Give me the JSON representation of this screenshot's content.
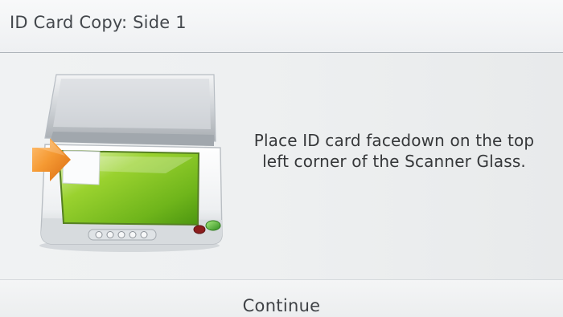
{
  "header": {
    "title": "ID Card Copy: Side 1"
  },
  "main": {
    "instruction": "Place ID card facedown on the top left corner of the Scanner Glass.",
    "illustration_icon": "scanner-with-id-card-icon",
    "accent_colors": {
      "glass_green": "#7fc51b",
      "arrow_orange": "#f08a22",
      "power_led": "#4bb032"
    }
  },
  "footer": {
    "continue_label": "Continue"
  }
}
